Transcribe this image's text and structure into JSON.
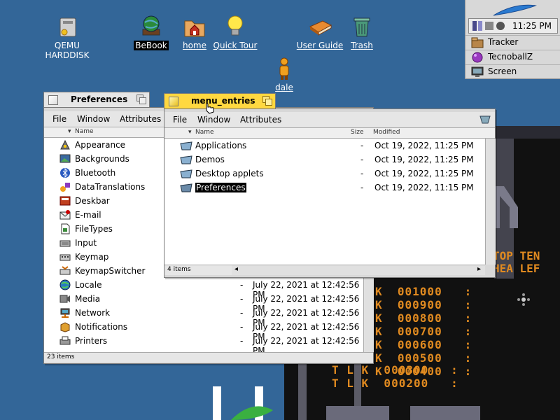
{
  "desktop": {
    "icons": [
      {
        "label": "QEMU HARDDISK",
        "icon": "harddisk-icon"
      },
      {
        "label": "BeBook",
        "icon": "globe-book-icon"
      },
      {
        "label": "home",
        "icon": "home-folder-icon"
      },
      {
        "label": "Quick Tour",
        "icon": "lightbulb-icon"
      },
      {
        "label": "User Guide",
        "icon": "book-icon"
      },
      {
        "label": "Trash",
        "icon": "trash-icon"
      },
      {
        "label": "dale",
        "icon": "person-icon"
      }
    ]
  },
  "deskbar": {
    "clock": "11:25 PM",
    "apps": [
      {
        "label": "Tracker",
        "icon": "tracker-icon"
      },
      {
        "label": "TecnoballZ",
        "icon": "ball-icon"
      },
      {
        "label": "Screen",
        "icon": "screen-icon"
      }
    ]
  },
  "prefs_window": {
    "title": "Preferences",
    "menu": [
      "File",
      "Window",
      "Attributes"
    ],
    "col_name": "Name",
    "items": [
      {
        "name": "Appearance",
        "modified": ""
      },
      {
        "name": "Backgrounds",
        "modified": ""
      },
      {
        "name": "Bluetooth",
        "modified": ""
      },
      {
        "name": "DataTranslations",
        "modified": ""
      },
      {
        "name": "Deskbar",
        "modified": ""
      },
      {
        "name": "E-mail",
        "modified": ""
      },
      {
        "name": "FileTypes",
        "modified": ""
      },
      {
        "name": "Input",
        "modified": ""
      },
      {
        "name": "Keymap",
        "modified": ""
      },
      {
        "name": "KeymapSwitcher",
        "modified": ""
      },
      {
        "name": "Locale",
        "size": "-",
        "modified": "July 22, 2021 at 12:42:56 PM"
      },
      {
        "name": "Media",
        "size": "-",
        "modified": "July 22, 2021 at 12:42:56 PM"
      },
      {
        "name": "Network",
        "size": "-",
        "modified": "July 22, 2021 at 12:42:56 PM"
      },
      {
        "name": "Notifications",
        "size": "-",
        "modified": "July 22, 2021 at 12:42:56 PM"
      },
      {
        "name": "Printers",
        "size": "-",
        "modified": "July 22, 2021 at 12:42:56 PM"
      }
    ],
    "status": "23 items"
  },
  "menu_window": {
    "title": "menu_entries",
    "menu": [
      "File",
      "Window",
      "Attributes"
    ],
    "col_name": "Name",
    "col_size": "Size",
    "col_modified": "Modified",
    "items": [
      {
        "name": "Applications",
        "size": "-",
        "modified": "Oct 19, 2022, 11:25 PM"
      },
      {
        "name": "Demos",
        "size": "-",
        "modified": "Oct 19, 2022, 11:25 PM"
      },
      {
        "name": "Desktop applets",
        "size": "-",
        "modified": "Oct 19, 2022, 11:25 PM"
      },
      {
        "name": "Preferences",
        "size": "-",
        "modified": "Oct 19, 2022, 11:15 PM"
      }
    ],
    "status": "4 items"
  },
  "game": {
    "banner_top": "TOP TEN",
    "banner_bottom": "HEA LEF",
    "scores": [
      {
        "line": "K  001000   :"
      },
      {
        "line": "K  000900   :"
      },
      {
        "line": "K  000800   :"
      },
      {
        "line": "K  000700   :"
      },
      {
        "line": "K  000600   :"
      },
      {
        "line": "K  000500   :"
      },
      {
        "line": "K  000400   :"
      },
      {
        "line": "T L K  000300   :"
      },
      {
        "line": "T L K  000200   :"
      }
    ]
  }
}
